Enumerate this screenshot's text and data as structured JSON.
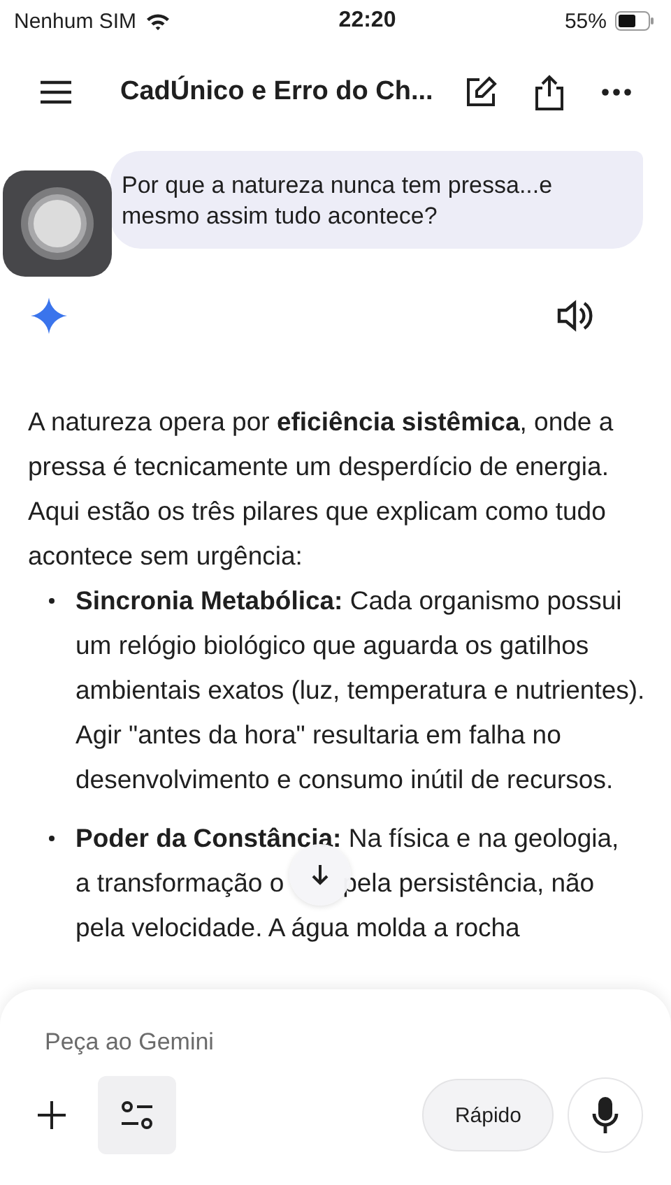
{
  "status_bar": {
    "carrier": "Nenhum SIM",
    "time": "22:20",
    "battery": "55%"
  },
  "header": {
    "title": "CadÚnico e Erro do Ch..."
  },
  "user_message": "Por que a natureza nunca tem pressa...e mesmo assim tudo acontece?",
  "response": {
    "intro": "A natureza opera por **eficiência sistêmica**, onde a pressa é tecnicamente um desperdício de energia. Aqui estão os três pilares que explicam como tudo acontece sem urgência:",
    "bullets": [
      {
        "lines": [
          [
            "**Sincronia Metabólica:** Cada organismo possui um relógio biológico que aguarda os gatilhos ambientais exatos (luz, temperatura e nutrientes). Agir \"antes da hora\" resultaria em falha no desenvolvimento e consumo inútil de recursos."
          ]
        ]
      },
      {
        "lines": [
          [
            "**Poder da Constância:** Na física e na geologia,"
          ],
          [
            "a transformação o",
            "pela persistência, não"
          ],
          [
            "pela velocidade. A água molda a rocha"
          ]
        ]
      }
    ]
  },
  "input": {
    "placeholder": "Peça ao Gemini",
    "mode_button": "Rápido"
  }
}
